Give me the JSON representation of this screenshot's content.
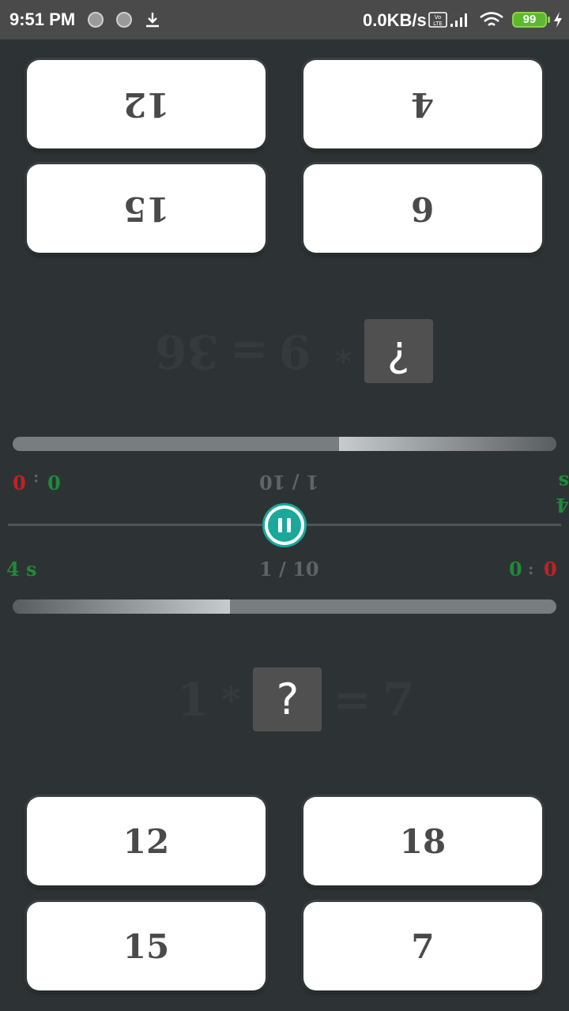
{
  "status_bar": {
    "time": "9:51 PM",
    "network_speed": "0.0KB/s",
    "volte": "Vo LTE",
    "battery": "99"
  },
  "top_player": {
    "answers": [
      "12",
      "4",
      "15",
      "6"
    ],
    "equation": {
      "left": "¿",
      "operator": "*",
      "operand": "9",
      "equals": "=",
      "result": "36"
    },
    "progress": 0.4,
    "time_left": "4 s",
    "round": "1 / 10",
    "score_correct": "0",
    "score_separator": ":",
    "score_wrong": "0"
  },
  "bottom_player": {
    "answers": [
      "12",
      "18",
      "15",
      "7"
    ],
    "equation": {
      "operand": "1",
      "operator": "*",
      "unknown": "?",
      "equals": "=",
      "result": "7"
    },
    "progress": 0.4,
    "time_left": "4 s",
    "round": "1 / 10",
    "score_correct": "0",
    "score_separator": ":",
    "score_wrong": "0"
  },
  "colors": {
    "background": "#2d3335",
    "accent": "#1aa89b",
    "correct": "#1f8a3a",
    "wrong": "#c62020"
  }
}
